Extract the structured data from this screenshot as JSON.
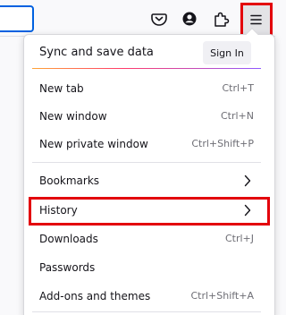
{
  "toolbar": {
    "icons": [
      "save-to-pocket-icon",
      "account-icon",
      "extensions-icon",
      "hamburger-menu-icon"
    ]
  },
  "menu": {
    "sync_label": "Sync and save data",
    "sign_in_label": "Sign In",
    "items": [
      {
        "label": "New tab",
        "shortcut": "Ctrl+T"
      },
      {
        "label": "New window",
        "shortcut": "Ctrl+N"
      },
      {
        "label": "New private window",
        "shortcut": "Ctrl+Shift+P"
      },
      {
        "label": "Bookmarks",
        "icon": "chevron-right-icon"
      },
      {
        "label": "History",
        "icon": "chevron-right-icon"
      },
      {
        "label": "Downloads",
        "shortcut": "Ctrl+J"
      },
      {
        "label": "Passwords"
      },
      {
        "label": "Add-ons and themes",
        "shortcut": "Ctrl+Shift+A"
      }
    ]
  },
  "highlight_color": "#e3000b",
  "accent_color": "#0061e0"
}
